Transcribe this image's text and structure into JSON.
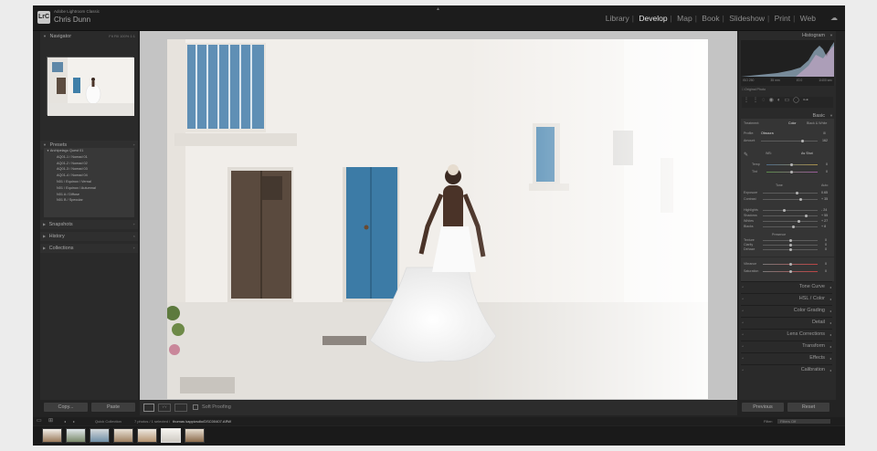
{
  "app": {
    "name": "Adobe Lightroom Classic",
    "user": "Chris Dunn",
    "logo": "LrC",
    "modules": [
      "Library",
      "Develop",
      "Map",
      "Book",
      "Slideshow",
      "Print",
      "Web"
    ],
    "active_module": "Develop"
  },
  "left": {
    "navigator": {
      "label": "Navigator",
      "zoom": [
        "Fit",
        "Fill",
        "100%",
        "1:1"
      ]
    },
    "presets": {
      "label": "Presets",
      "group": "Archipelago Quest 01",
      "items": [
        "AQ01-1 / Nomad 01",
        "AQ01-2 / Nomad 02",
        "AQ01-3 / Nomad 03",
        "AQ01-4 / Nomad 04",
        "N01 / Equinox / Vernal",
        "N01 / Equinox / Autumnal",
        "N01 A / Diffuse",
        "N01 B / Specular"
      ]
    },
    "snapshots": "Snapshots",
    "history": "History",
    "collections": "Collections",
    "copy_btn": "Copy...",
    "paste_btn": "Paste"
  },
  "toolbar": {
    "soft_proofing": "Soft Proofing"
  },
  "right": {
    "histogram": {
      "label": "Histogram",
      "info": [
        "ISO 250",
        "35 mm",
        "f/2.0",
        "1/400 sec"
      ],
      "original_photo": "Original Photo"
    },
    "basic": {
      "label": "Basic",
      "treatment_label": "Treatment:",
      "treatment": [
        "Color",
        "Black & White"
      ],
      "profile_label": "Profile:",
      "profile": "Obscura",
      "amount_label": "Amount",
      "amount": "162",
      "wb_label": "WB:",
      "wb": "As Shot",
      "temp_label": "Temp",
      "temp": "0",
      "tint_label": "Tint",
      "tint": "0",
      "tone_label": "Tone",
      "auto": "Auto",
      "sliders": [
        {
          "label": "Exposure",
          "value": "0.65"
        },
        {
          "label": "Contrast",
          "value": "+ 35"
        },
        {
          "label": "Highlights",
          "value": "- 24"
        },
        {
          "label": "Shadows",
          "value": "+ 55"
        },
        {
          "label": "Whites",
          "value": "+ 27"
        },
        {
          "label": "Blacks",
          "value": "+ 8"
        }
      ],
      "presence_label": "Presence",
      "presence": [
        {
          "label": "Texture",
          "value": "0"
        },
        {
          "label": "Clarity",
          "value": "0"
        },
        {
          "label": "Dehaze",
          "value": "0"
        },
        {
          "label": "Vibrance",
          "value": "0"
        },
        {
          "label": "Saturation",
          "value": "0"
        }
      ]
    },
    "sections": [
      "Tone Curve",
      "HSL / Color",
      "Color Grading",
      "Detail",
      "Lens Corrections",
      "Transform",
      "Effects",
      "Calibration"
    ],
    "previous_btn": "Previous",
    "reset_btn": "Reset"
  },
  "filmstrip": {
    "source": "Quick Collection",
    "count": "7 photos / 1 selected /",
    "filename": "thomas kappizsdio/DSC00407.ARW",
    "filter_label": "Filter:",
    "filter_value": "Filters Off"
  },
  "colors": {
    "accent": "#e8e8e8",
    "panel": "#2a2a2a",
    "background": "#232323"
  }
}
